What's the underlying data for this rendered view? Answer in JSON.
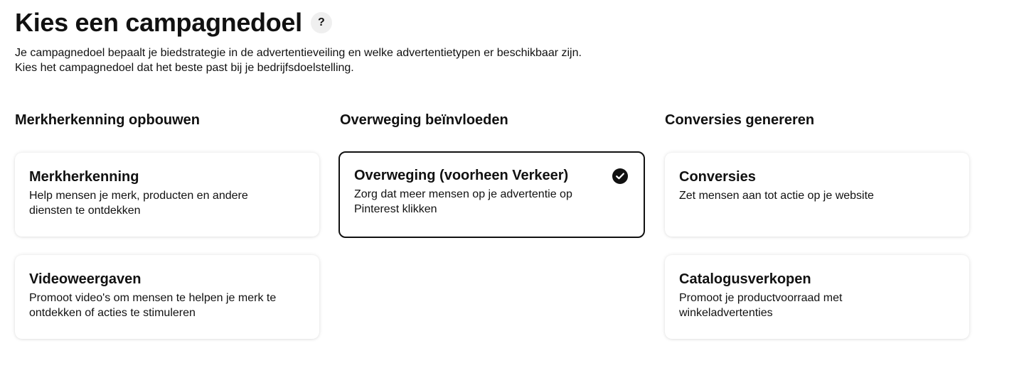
{
  "header": {
    "title": "Kies een campagnedoel",
    "help_label": "?",
    "description_line1": "Je campagnedoel bepaalt je biedstrategie in de advertentieveiling en welke advertentietypen er beschikbaar zijn.",
    "description_line2": "Kies het campagnedoel dat het beste past bij je bedrijfsdoelstelling."
  },
  "columns": [
    {
      "heading": "Merkherkenning opbouwen",
      "cards": [
        {
          "title": "Merkherkenning",
          "description": "Help mensen je merk, producten en andere diensten te ontdekken",
          "selected": false
        },
        {
          "title": "Videoweergaven",
          "description": "Promoot video's om mensen te helpen je merk te ontdekken of acties te stimuleren",
          "selected": false
        }
      ]
    },
    {
      "heading": "Overweging beïnvloeden",
      "cards": [
        {
          "title": "Overweging (voorheen Verkeer)",
          "description": "Zorg dat meer mensen op je advertentie op Pinterest klikken",
          "selected": true
        }
      ]
    },
    {
      "heading": "Conversies genereren",
      "cards": [
        {
          "title": "Conversies",
          "description": "Zet mensen aan tot actie op je website",
          "selected": false
        },
        {
          "title": "Catalogusverkopen",
          "description": "Promoot je productvoorraad met winkeladvertenties",
          "selected": false
        }
      ]
    }
  ],
  "colors": {
    "text": "#111111",
    "selected_border": "#111111",
    "help_bg": "#efefef"
  },
  "icons": {
    "help": "question-mark-icon",
    "selected": "check-circle-icon"
  }
}
